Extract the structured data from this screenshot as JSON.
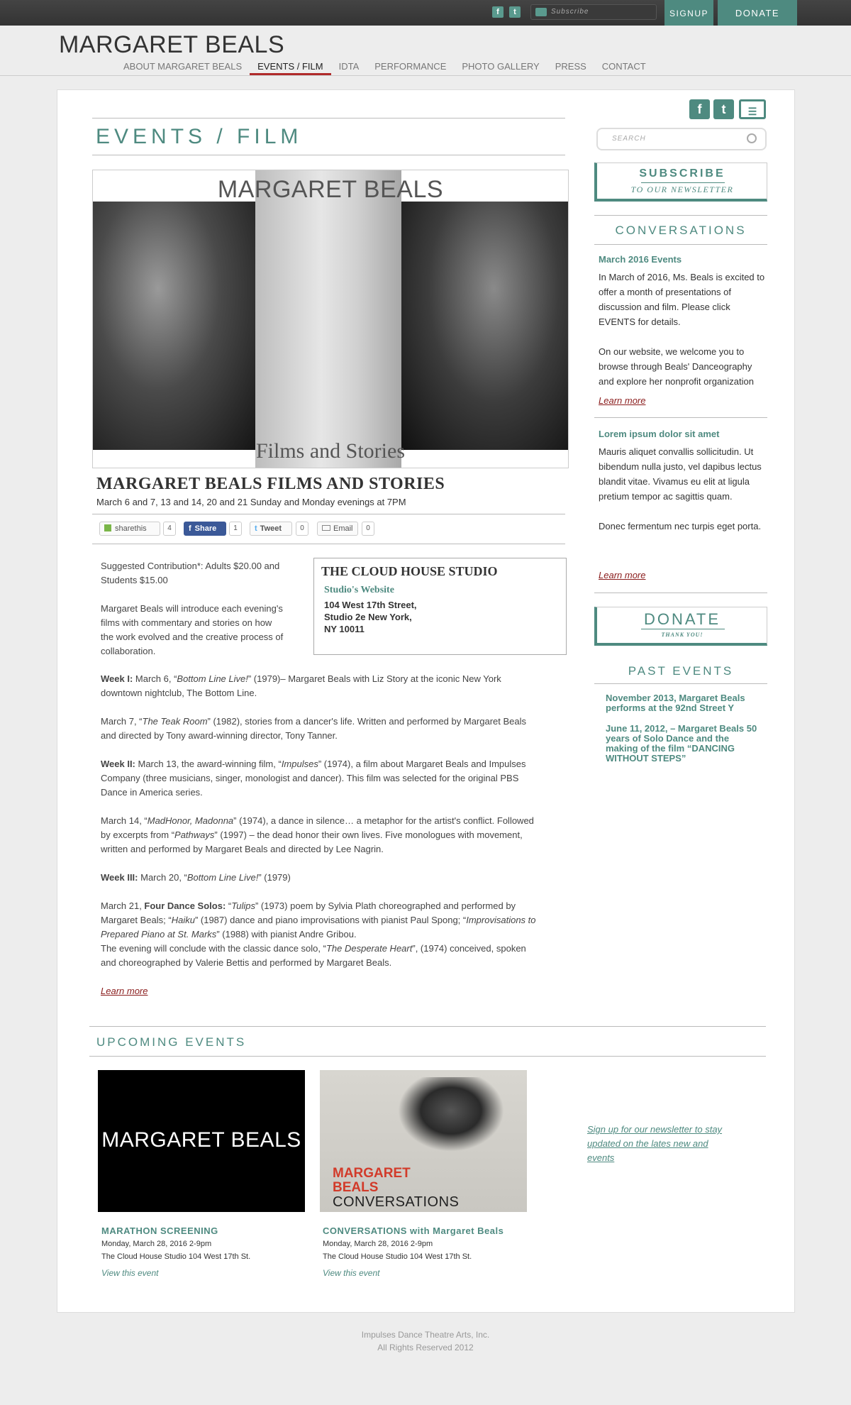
{
  "topbar": {
    "subscribe_placeholder": "Subscribe",
    "signup_label": "SIGNUP",
    "donate_label": "DONATE"
  },
  "header": {
    "site_title": "MARGARET BEALS",
    "nav": [
      "ABOUT MARGARET BEALS",
      "EVENTS / FILM",
      "IDTA",
      "PERFORMANCE",
      "PHOTO GALLERY",
      "PRESS",
      "CONTACT"
    ],
    "active_nav": "EVENTS / FILM"
  },
  "main": {
    "page_title": "EVENTS / FILM",
    "hero": {
      "brand": "MARGARET BEALS",
      "caption": "Films and Stories"
    },
    "event_title": "MARGARET BEALS  FILMS AND STORIES",
    "event_dates": "March 6 and 7, 13 and 14, 20 and 21 Sunday and Monday evenings at 7PM",
    "share": {
      "sharethis_label": "sharethis",
      "sharethis_count": "4",
      "fb_label": "Share",
      "fb_count": "1",
      "tweet_label": "Tweet",
      "tweet_count": "0",
      "email_label": "Email",
      "email_count": "0"
    },
    "intro": {
      "contribution": "Suggested Contribution*: Adults $20.00 and Students $15.00",
      "description": "Margaret Beals will introduce each evening's films with commentary and stories on how the work evolved and the creative process of collaboration."
    },
    "studio": {
      "name": "THE CLOUD HOUSE STUDIO",
      "website_label": "Studio's Website",
      "address_line1": "104 West 17th Street,",
      "address_line2": "Studio 2e New York,",
      "address_line3": "NY 10011"
    },
    "paragraphs": {
      "p1_lead": "Week I:",
      "p1_a": " March 6, “",
      "p1_i": "Bottom Line Live!",
      "p1_b": "” (1979)– Margaret Beals with Liz Story at the iconic New York downtown nightclub, The Bottom Line.",
      "p2_a": "March 7, “",
      "p2_i": "The Teak Room",
      "p2_b": "” (1982), stories from a dancer's life. Written and performed by Margaret Beals and directed by Tony award-winning director, Tony Tanner.",
      "p3_lead": "Week II:",
      "p3_a": " March 13, the award-winning film, “",
      "p3_i": "Impulses",
      "p3_b": "” (1974), a film about Margaret Beals and Impulses Company (three musicians, singer, monologist and dancer). This film was selected for the original PBS Dance in America series.",
      "p4_a": "March 14, “",
      "p4_i": "MadHonor, Madonna",
      "p4_b": "” (1974), a dance in silence… a metaphor for the artist's conflict. Followed by excerpts from “",
      "p4_i2": "Pathways",
      "p4_c": "” (1997) – the dead honor their own lives. Five monologues with movement, written and performed by Margaret Beals and directed by Lee Nagrin.",
      "p5_lead": "Week III:",
      "p5_a": " March 20, “",
      "p5_i": "Bottom Line Live!",
      "p5_b": "” (1979)",
      "p6_a": "March 21, ",
      "p6_lead": "Four Dance Solos:",
      "p6_b": " “",
      "p6_i1": "Tulips",
      "p6_c": "” (1973) poem by Sylvia Plath choreographed and performed by Margaret Beals; “",
      "p6_i2": "Haiku",
      "p6_d": "” (1987) dance and piano improvisations with pianist Paul Spong; “",
      "p6_i3": "Improvisations to Prepared Piano at St. Marks",
      "p6_e": "” (1988) with pianist Andre Gribou.",
      "p6_f": "The evening will conclude with the classic dance solo, “",
      "p6_i4": "The Desperate Heart",
      "p6_g": "”, (1974) conceived, spoken and choreographed by Valerie Bettis and performed by Margaret Beals."
    },
    "learn_more": "Learn more"
  },
  "sidebar": {
    "search_placeholder": "SEARCH",
    "subscribe_title": "SUBSCRIBE",
    "subscribe_sub": "TO OUR NEWSLETTER",
    "conversations_title": "CONVERSATIONS",
    "conv1_title": "March 2016 Events",
    "conv1_text_a": "In March of 2016, Ms. Beals is excited to offer a month of presentations of discussion and film. Please click EVENTS for details.",
    "conv1_text_b": "On our website, we welcome you to browse through Beals' Danceography and explore her nonprofit organization",
    "conv1_learn": "Learn more",
    "conv2_title": "Lorem ipsum dolor sit amet",
    "conv2_text_a": "Mauris aliquet convallis sollicitudin. Ut bibendum nulla justo, vel dapibus lectus blandit vitae. Vivamus eu elit at ligula pretium tempor ac sagittis quam.",
    "conv2_text_b": "Donec fermentum nec turpis eget porta.",
    "conv2_learn": "Learn more",
    "donate_title": "DONATE",
    "donate_sub": "THANK YOU!",
    "past_title": "PAST EVENTS",
    "past1": "November 2013, Margaret Beals performs at the 92nd Street Y",
    "past2": "June 11, 2012, – Margaret Beals 50 years of Solo Dance and the making of the film “DANCING WITHOUT STEPS”"
  },
  "upcoming": {
    "title": "UPCOMING EVENTS",
    "events": [
      {
        "image_text": "MARGARET BEALS",
        "title": "MARATHON SCREENING",
        "date": "Monday, March 28, 2016 2-9pm",
        "place": "The Cloud House Studio 104 West 17th St.",
        "view": "View this event"
      },
      {
        "image_text_1": "MARGARET",
        "image_text_2": "BEALS",
        "image_text_3": "CONVERSATIONS",
        "title": "CONVERSATIONS with Margaret Beals",
        "date": "Monday, March 28, 2016 2-9pm",
        "place": "The Cloud House Studio 104 West 17th St.",
        "view": "View this event"
      }
    ],
    "newsletter_text": "Sign up for our newsletter to stay updated on the lates new and events"
  },
  "footer": {
    "line1": "Impulses Dance Theatre Arts, Inc.",
    "line2": "All Rights Reserved 2012"
  },
  "colors": {
    "accent": "#4e8a80",
    "nav_active": "#b02a2a",
    "link_red": "#8a1c1c"
  }
}
